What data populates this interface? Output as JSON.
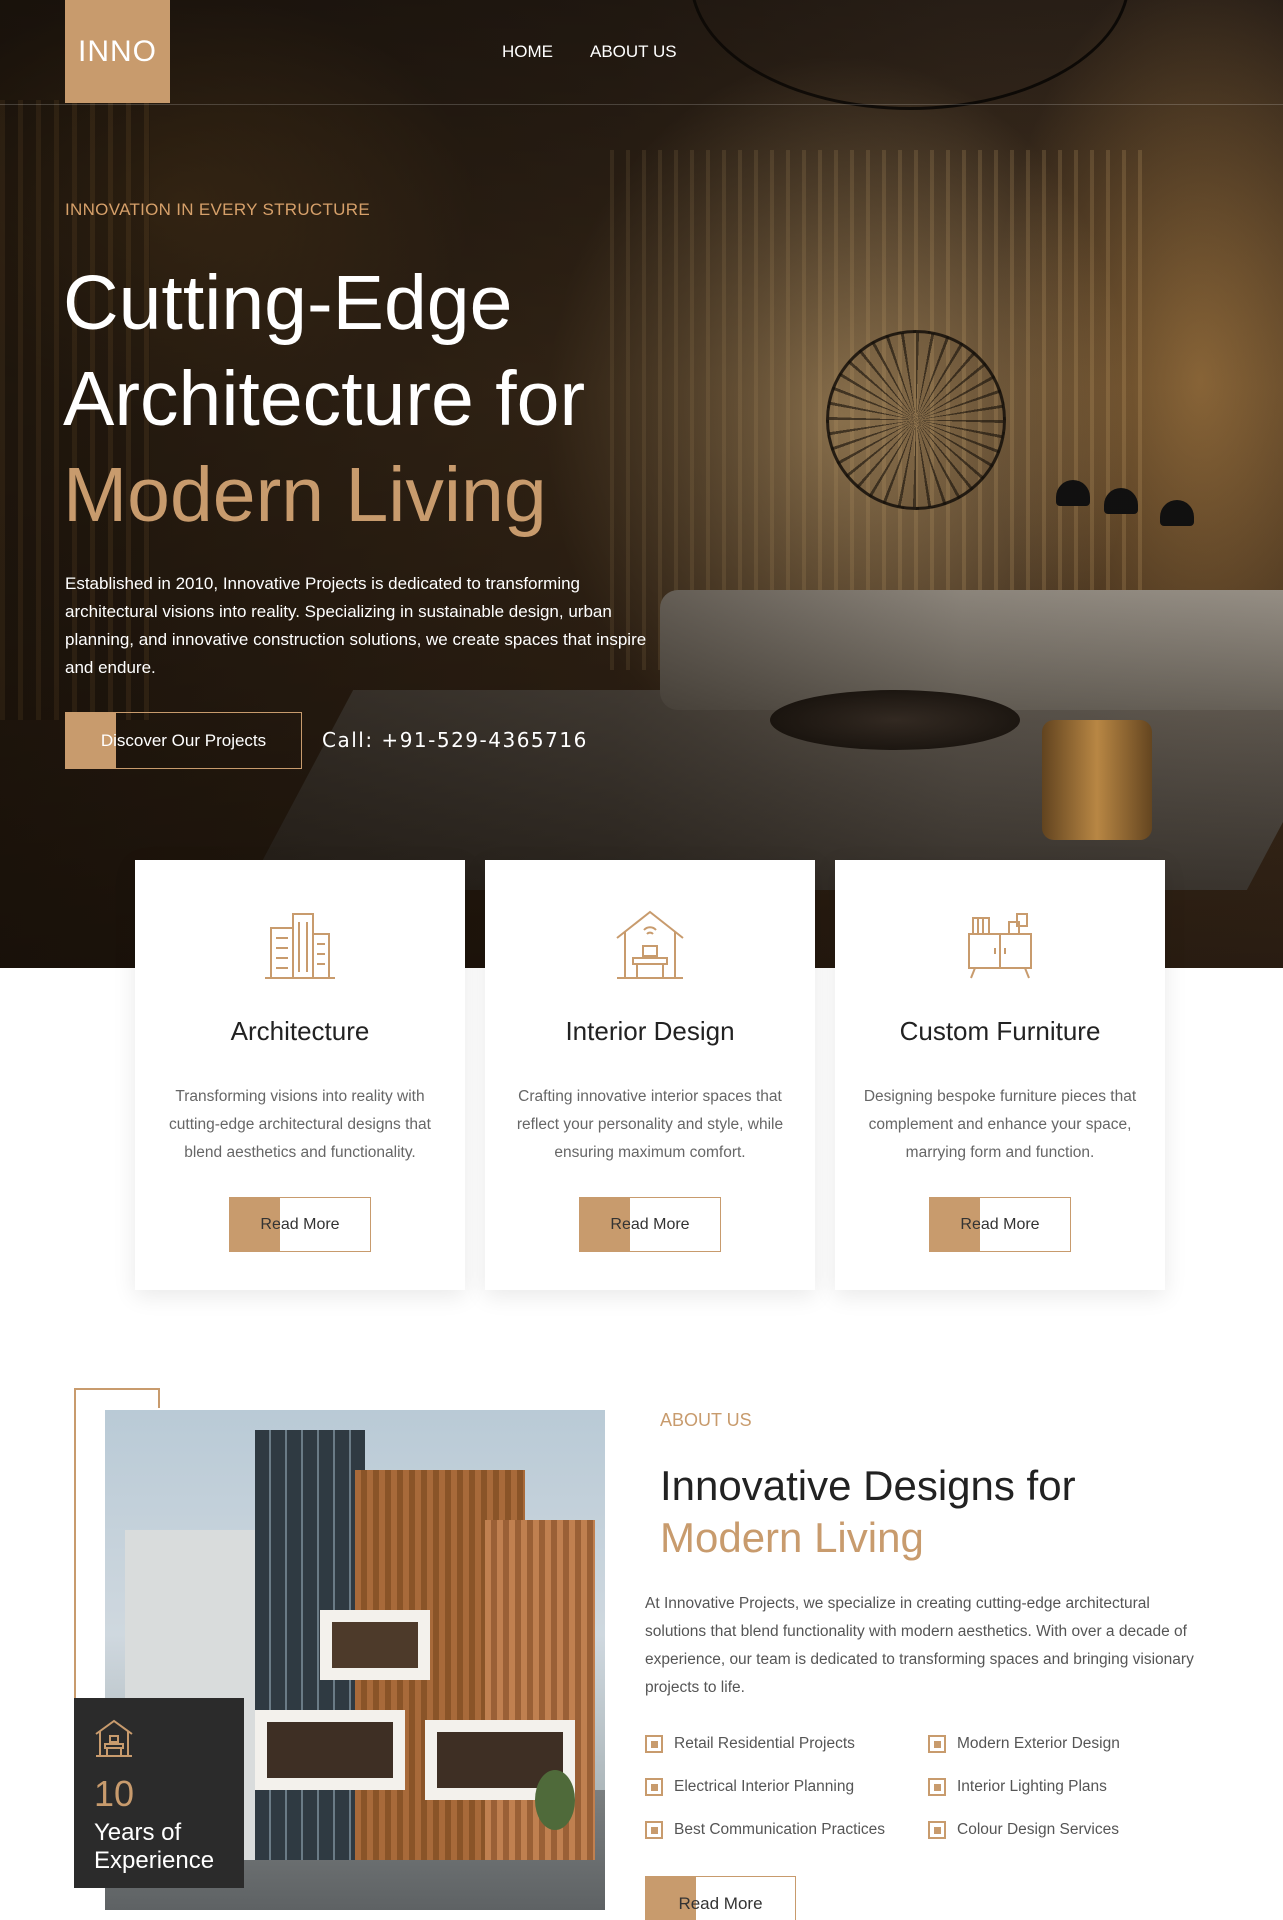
{
  "nav": {
    "logo": "INNO",
    "links": [
      "HOME",
      "ABOUT US"
    ]
  },
  "hero": {
    "eyebrow": "INNOVATION IN EVERY STRUCTURE",
    "title_line1": "Cutting-Edge",
    "title_line2": "Architecture for",
    "title_accent": "Modern Living",
    "description": "Established in 2010, Innovative Projects is dedicated to transforming architectural visions into reality. Specializing in sustainable design, urban planning, and innovative construction solutions, we create spaces that inspire and endure.",
    "cta": "Discover Our Projects",
    "call": "Call: +91-529-4365716"
  },
  "services": [
    {
      "icon": "building-icon",
      "title": "Architecture",
      "text": "Transforming visions into reality with cutting-edge architectural designs that blend aesthetics and functionality.",
      "button": "Read More"
    },
    {
      "icon": "house-desk-icon",
      "title": "Interior Design",
      "text": "Crafting innovative interior spaces that reflect your personality and style, while ensuring maximum comfort.",
      "button": "Read More"
    },
    {
      "icon": "cabinet-icon",
      "title": "Custom Furniture",
      "text": "Designing bespoke furniture pieces that complement and enhance your space, marrying form and function.",
      "button": "Read More"
    }
  ],
  "about": {
    "eyebrow": "ABOUT US",
    "title_line1": "Innovative Designs for",
    "title_accent": "Modern Living",
    "description": "At Innovative Projects, we specialize in creating cutting-edge architectural solutions that blend functionality with modern aesthetics. With over a decade of experience, our team is dedicated to transforming spaces and bringing visionary projects to life.",
    "experience_number": "10",
    "experience_label": "Years of Experience",
    "features": [
      "Retail Residential Projects",
      "Modern Exterior Design",
      "Electrical Interior Planning",
      "Interior Lighting Plans",
      "Best Communication Practices",
      "Colour Design Services"
    ],
    "button": "Read More"
  },
  "colors": {
    "accent": "#c89b6d",
    "dark": "#2b2b2b"
  }
}
